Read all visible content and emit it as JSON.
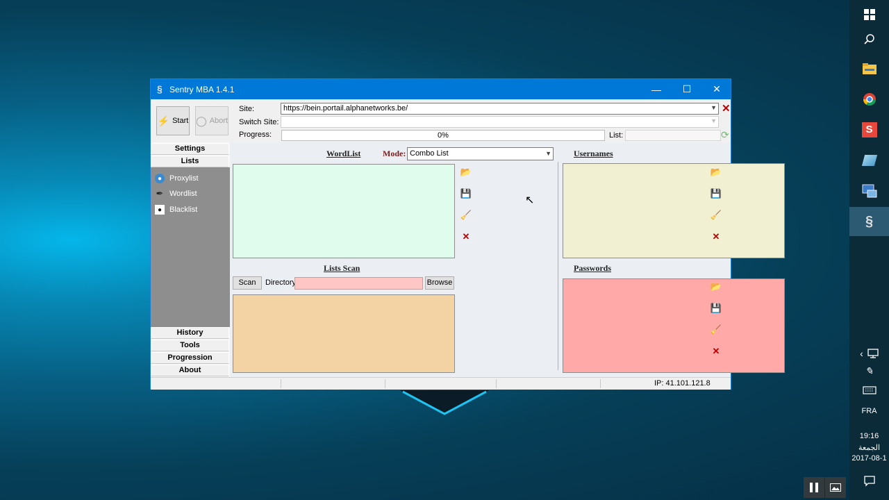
{
  "window": {
    "title": "Sentry MBA 1.4.1",
    "controls": {
      "minimize": "—",
      "maximize": "☐",
      "close": "✕"
    }
  },
  "toolbar": {
    "start_label": "Start",
    "abort_label": "Abort",
    "site_label": "Site:",
    "site_value": "https://bein.portail.alphanetworks.be/",
    "switch_site_label": "Switch Site:",
    "switch_site_value": "",
    "progress_label": "Progress:",
    "progress_text": "0%",
    "progress_value": 0,
    "list_label": "List:"
  },
  "nav": {
    "tabs_top": [
      "Settings",
      "Lists"
    ],
    "items": [
      {
        "label": "Proxylist",
        "icon": "globe-icon"
      },
      {
        "label": "Wordlist",
        "icon": "feather-icon"
      },
      {
        "label": "Blacklist",
        "icon": "blacklist-icon"
      }
    ],
    "tabs_bottom": [
      "History",
      "Tools",
      "Progression",
      "About"
    ]
  },
  "main": {
    "wordlist_title": "WordList",
    "mode_label": "Mode:",
    "mode_value": "Combo List",
    "usernames_title": "Usernames",
    "lists_scan_title": "Lists Scan",
    "scan_button": "Scan",
    "directory_label": "Directory",
    "directory_value": "",
    "browse_button": "Browse",
    "passwords_title": "Passwords"
  },
  "colors": {
    "wordlist_bg": "#e0fced",
    "usernames_bg": "#f2f0d2",
    "scan_bg": "#f3d3a3",
    "passwords_bg": "#ffaaa8",
    "directory_bg": "#ffc6c6"
  },
  "statusbar": {
    "ip_text": "IP: 41.101.121.8"
  },
  "taskbar": {
    "language": "FRA",
    "time": "19:16",
    "day": "الجمعة",
    "date": "2017-08-1"
  }
}
